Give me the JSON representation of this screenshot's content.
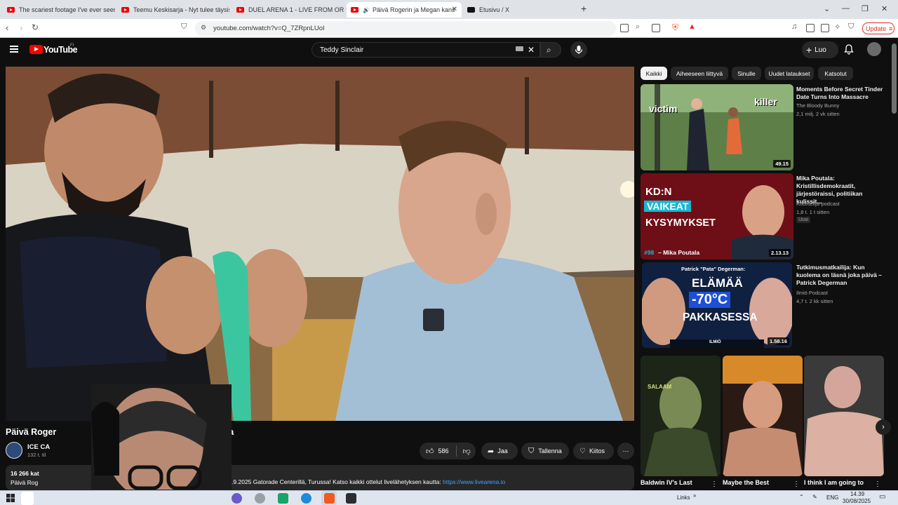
{
  "browser": {
    "tabs": [
      {
        "title": "The scariest footage I've ever seen..."
      },
      {
        "title": "Teemu Keskisarja - Nyt tulee täysisi"
      },
      {
        "title": "DUEL ARENA 1 - LIVE FROM ORLAND"
      },
      {
        "title": "Päivä Rogerin ja Megan kans"
      },
      {
        "title": "Etusivu / X"
      }
    ],
    "new_tab": "+",
    "url": "youtube.com/watch?v=Q_7ZRpnLUoI",
    "update_label": "Update"
  },
  "youtube": {
    "logo_text": "YouTube",
    "country_code": "FI",
    "search_value": "Teddy Sinclair",
    "create_label": "Luo"
  },
  "video": {
    "title_left": "Päivä Roger",
    "title_right": "nna",
    "channel_name": "ICE CA",
    "channel_subs": "132 t. til",
    "like_count": "586",
    "share_label": "Jaa",
    "save_label": "Tallenna",
    "thanks_label": "Kiitos",
    "desc_views": "16 266 kat",
    "desc_sub": "Päivä Rog",
    "desc_text": "ssa 19.9.2025 Gatorade Centerillä, Turussa! Katso kaikki ottelut livelähetyksen kautta: ",
    "desc_link": "https://www.livearena.io"
  },
  "chips": [
    "Kaikki",
    "Aiheeseen liittyvä",
    "Sinulle",
    "Uudet lataukset",
    "Katsotut"
  ],
  "recommended": [
    {
      "title": "Moments Before Secret Tinder Date Turns Into Massacre",
      "channel": "The Bloody Bunny",
      "meta": "2,1 milj.  2 vk sitten",
      "duration": "49.15",
      "thumb_text_1": "victim",
      "thumb_text_2": "killer"
    },
    {
      "title": "Mika Poutala: Kristillisdemokraatit, järjestöraissi, politiikan kulissit...",
      "channel": "Kuuntelija-podcast",
      "meta": "1,8 t.  1 t sitten",
      "badge": "Uusi",
      "duration": "2.13.13",
      "thumb_text_1": "KD:N",
      "thumb_text_2": "VAIKEAT",
      "thumb_text_3": "KYSYMYKSET",
      "thumb_text_4": "#98",
      "thumb_text_5": "– Mika Poutala"
    },
    {
      "title": "Tutkimusmatkailija: Kun kuolema on läsnä joka päivä – Patrick Degerman",
      "channel": "Ilmiö Podcast",
      "meta": "4,7 t.  2 kk sitten",
      "duration": "1.58.16",
      "thumb_text_1": "Patrick \"Pata\" Degerman:",
      "thumb_text_2": "ELÄMÄÄ",
      "thumb_text_3": "-70°C",
      "thumb_text_4": "PAKKASESSA",
      "thumb_text_5": "ILMIÖ"
    }
  ],
  "shorts": [
    {
      "title": "Baldwin IV's Last",
      "overlay": "SALAAM"
    },
    {
      "title": "Maybe the Best"
    },
    {
      "title": "I think I am going to"
    }
  ],
  "taskbar": {
    "links_label": "Links",
    "lang": "ENG",
    "time": "14.39",
    "date": "30/08/2025"
  },
  "colors": {
    "yt_red": "#ff0000",
    "bg": "#0f0f0f",
    "link": "#3ea6ff"
  }
}
